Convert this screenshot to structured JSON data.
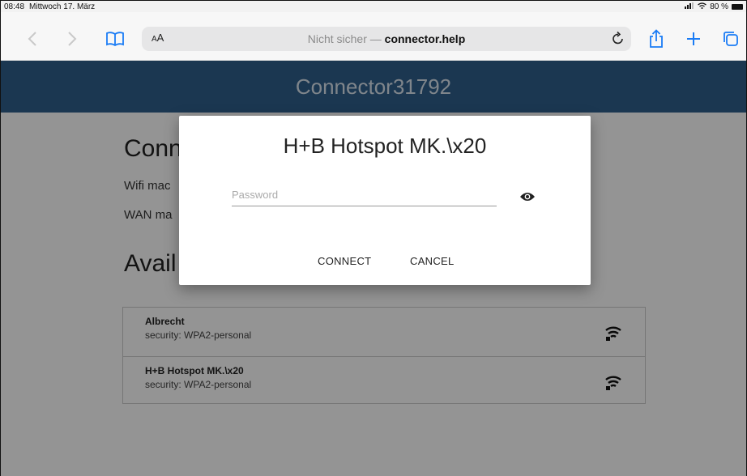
{
  "status_bar": {
    "time": "08:48",
    "date": "Mittwoch 17. März",
    "battery": "80 %"
  },
  "browser": {
    "back_icon": "chevron-left-icon",
    "forward_icon": "chevron-right-icon",
    "bookmarks_icon": "book-icon",
    "reader_label_large": "A",
    "reader_label_small": "A",
    "url_prefix": "Nicht sicher — ",
    "url_domain": "connector.help",
    "reload_icon": "reload-icon",
    "share_icon": "share-icon",
    "new_tab_icon": "plus-icon",
    "tabs_icon": "tabs-icon",
    "accent_color": "#1a7cf5"
  },
  "page": {
    "header_title": "Connector31792",
    "header_color": "#2f5f8c",
    "content_title": "Conn",
    "wifi_mac_label": "Wifi mac",
    "wan_mac_label": "WAN ma",
    "section_title": "Avail",
    "networks": [
      {
        "name": "Albrecht",
        "security": "security: WPA2-personal"
      },
      {
        "name": "H+B Hotspot MK.\\x20",
        "security": "security: WPA2-personal"
      }
    ]
  },
  "dialog": {
    "title": "H+B Hotspot MK.\\x20",
    "password_placeholder": "Password",
    "password_value": "",
    "connect_label": "CONNECT",
    "cancel_label": "CANCEL"
  }
}
